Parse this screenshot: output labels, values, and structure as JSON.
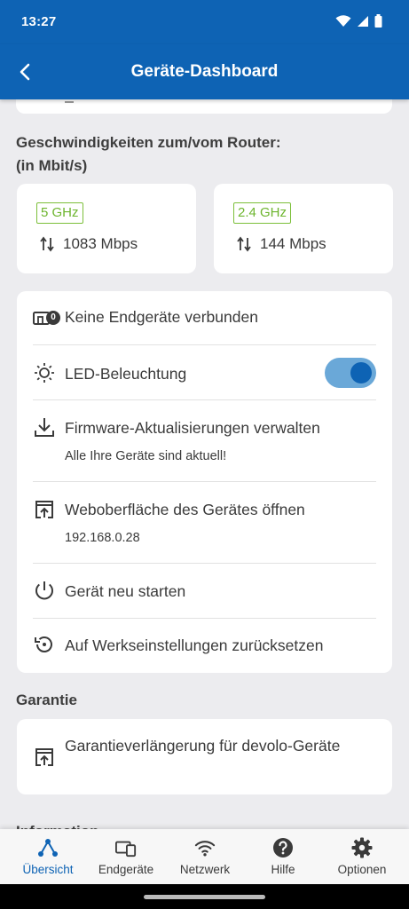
{
  "status": {
    "time": "13:27"
  },
  "appbar": {
    "title": "Geräte-Dashboard"
  },
  "speeds": {
    "heading_line1": "Geschwindigkeiten zum/vom Router:",
    "heading_line2": "(in Mbit/s)",
    "cards": [
      {
        "band": "5 GHz",
        "value": "1083 Mbps"
      },
      {
        "band": "2.4 GHz",
        "value": "144 Mbps"
      }
    ]
  },
  "actions": {
    "devices": {
      "label": "Keine Endgeräte verbunden",
      "count": "0"
    },
    "led": {
      "label": "LED-Beleuchtung",
      "enabled": true
    },
    "firmware": {
      "label": "Firmware-Aktualisierungen verwalten",
      "sub": "Alle Ihre Geräte sind aktuell!"
    },
    "webui": {
      "label": "Weboberfläche des Gerätes öffnen",
      "sub": "192.168.0.28"
    },
    "restart": {
      "label": "Gerät neu starten"
    },
    "reset": {
      "label": "Auf Werkseinstellungen zurücksetzen"
    }
  },
  "garantie": {
    "heading": "Garantie",
    "item_label": "Garantieverlängerung für devolo-Geräte"
  },
  "information": {
    "heading": "Information"
  },
  "nav": {
    "items": [
      {
        "label": "Übersicht",
        "icon": "overview-icon",
        "active": true
      },
      {
        "label": "Endgeräte",
        "icon": "devices-icon",
        "active": false
      },
      {
        "label": "Netzwerk",
        "icon": "wifi-icon",
        "active": false
      },
      {
        "label": "Hilfe",
        "icon": "help-icon",
        "active": false
      },
      {
        "label": "Optionen",
        "icon": "gear-icon",
        "active": false
      }
    ]
  },
  "colors": {
    "primary": "#0e63b4",
    "accent_green": "#6db52e",
    "toggle_track": "#6aa8d8",
    "background": "#ececef"
  }
}
